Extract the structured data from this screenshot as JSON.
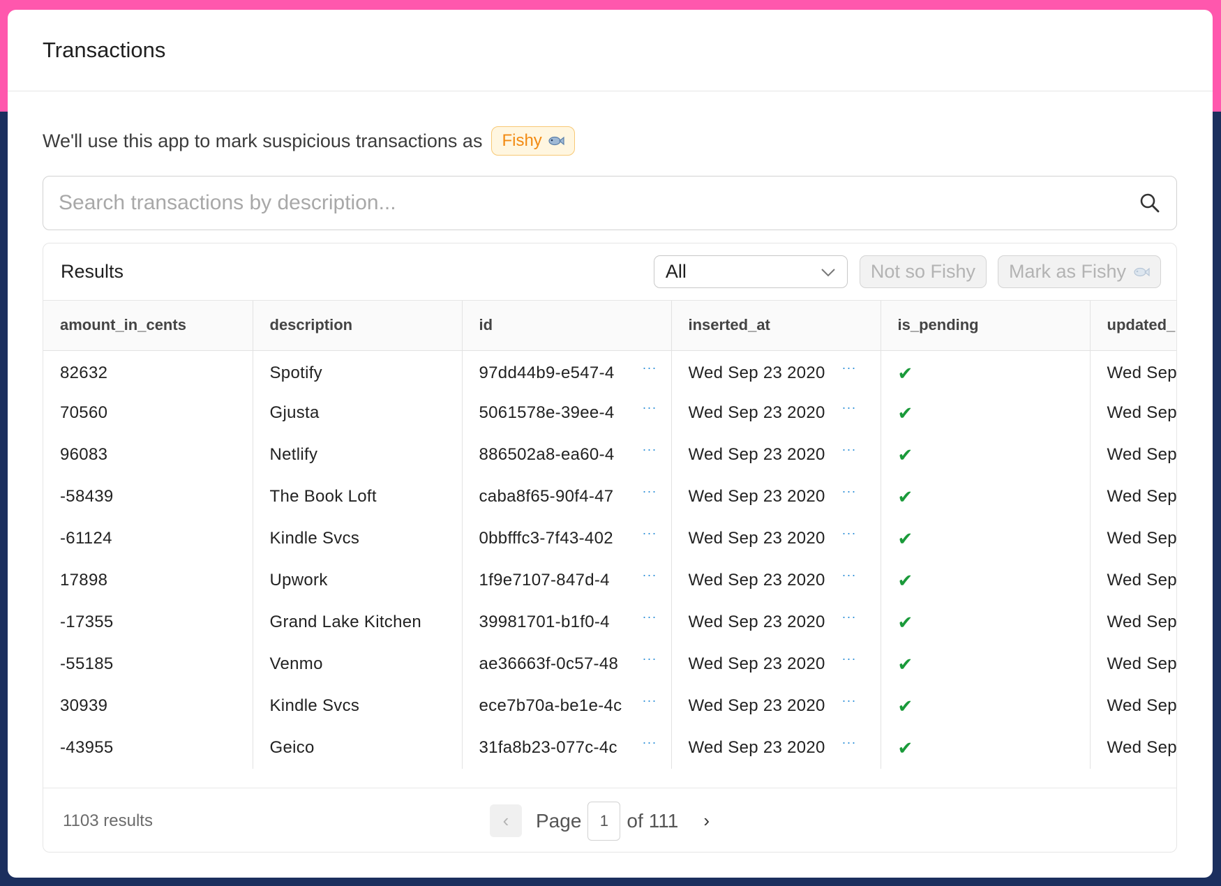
{
  "header": {
    "title": "Transactions"
  },
  "intro": {
    "text": "We'll use this app to mark suspicious transactions as",
    "chip_label": "Fishy"
  },
  "search": {
    "placeholder": "Search transactions by description..."
  },
  "results": {
    "title": "Results",
    "filter": {
      "selected": "All"
    },
    "not_fishy_label": "Not so Fishy",
    "mark_fishy_label": "Mark as Fishy"
  },
  "table": {
    "columns": [
      "amount_in_cents",
      "description",
      "id",
      "inserted_at",
      "is_pending",
      "updated_"
    ],
    "rows": [
      {
        "amount_in_cents": "82632",
        "description": "Spotify",
        "id": "97dd44b9-e547-4",
        "inserted_at": "Wed Sep 23 2020",
        "is_pending": "✔",
        "updated_at": "Wed Sep"
      },
      {
        "amount_in_cents": "70560",
        "description": "Gjusta",
        "id": "5061578e-39ee-4",
        "inserted_at": "Wed Sep 23 2020",
        "is_pending": "✔",
        "updated_at": "Wed Sep"
      },
      {
        "amount_in_cents": "96083",
        "description": "Netlify",
        "id": "886502a8-ea60-4",
        "inserted_at": "Wed Sep 23 2020",
        "is_pending": "✔",
        "updated_at": "Wed Sep"
      },
      {
        "amount_in_cents": "-58439",
        "description": "The Book Loft",
        "id": "caba8f65-90f4-47",
        "inserted_at": "Wed Sep 23 2020",
        "is_pending": "✔",
        "updated_at": "Wed Sep"
      },
      {
        "amount_in_cents": "-61124",
        "description": "Kindle Svcs",
        "id": "0bbfffc3-7f43-402",
        "inserted_at": "Wed Sep 23 2020",
        "is_pending": "✔",
        "updated_at": "Wed Sep"
      },
      {
        "amount_in_cents": "17898",
        "description": "Upwork",
        "id": "1f9e7107-847d-4",
        "inserted_at": "Wed Sep 23 2020",
        "is_pending": "✔",
        "updated_at": "Wed Sep"
      },
      {
        "amount_in_cents": "-17355",
        "description": "Grand Lake Kitchen",
        "id": "39981701-b1f0-4",
        "inserted_at": "Wed Sep 23 2020",
        "is_pending": "✔",
        "updated_at": "Wed Sep"
      },
      {
        "amount_in_cents": "-55185",
        "description": "Venmo",
        "id": "ae36663f-0c57-48",
        "inserted_at": "Wed Sep 23 2020",
        "is_pending": "✔",
        "updated_at": "Wed Sep"
      },
      {
        "amount_in_cents": "30939",
        "description": "Kindle Svcs",
        "id": "ece7b70a-be1e-4c",
        "inserted_at": "Wed Sep 23 2020",
        "is_pending": "✔",
        "updated_at": "Wed Sep"
      },
      {
        "amount_in_cents": "-43955",
        "description": "Geico",
        "id": "31fa8b23-077c-4c",
        "inserted_at": "Wed Sep 23 2020",
        "is_pending": "✔",
        "updated_at": "Wed Sep"
      }
    ]
  },
  "footer": {
    "result_count": "1103 results",
    "page_label": "Page",
    "current_page": "1",
    "of_label": "of",
    "total_pages": "111",
    "prev_icon": "‹",
    "next_icon": "›"
  },
  "icons": {
    "search": "search-icon",
    "more": "more-horizontal-icon",
    "check": "check-icon",
    "fish": "fish-icon",
    "chevron": "chevron-down-icon"
  },
  "colors": {
    "accent_pink": "#ff57ad",
    "navy": "#1b2f5e",
    "fishy_orange": "#f28a12",
    "check_green": "#1a9a3a",
    "link_blue": "#2b8fd8"
  }
}
